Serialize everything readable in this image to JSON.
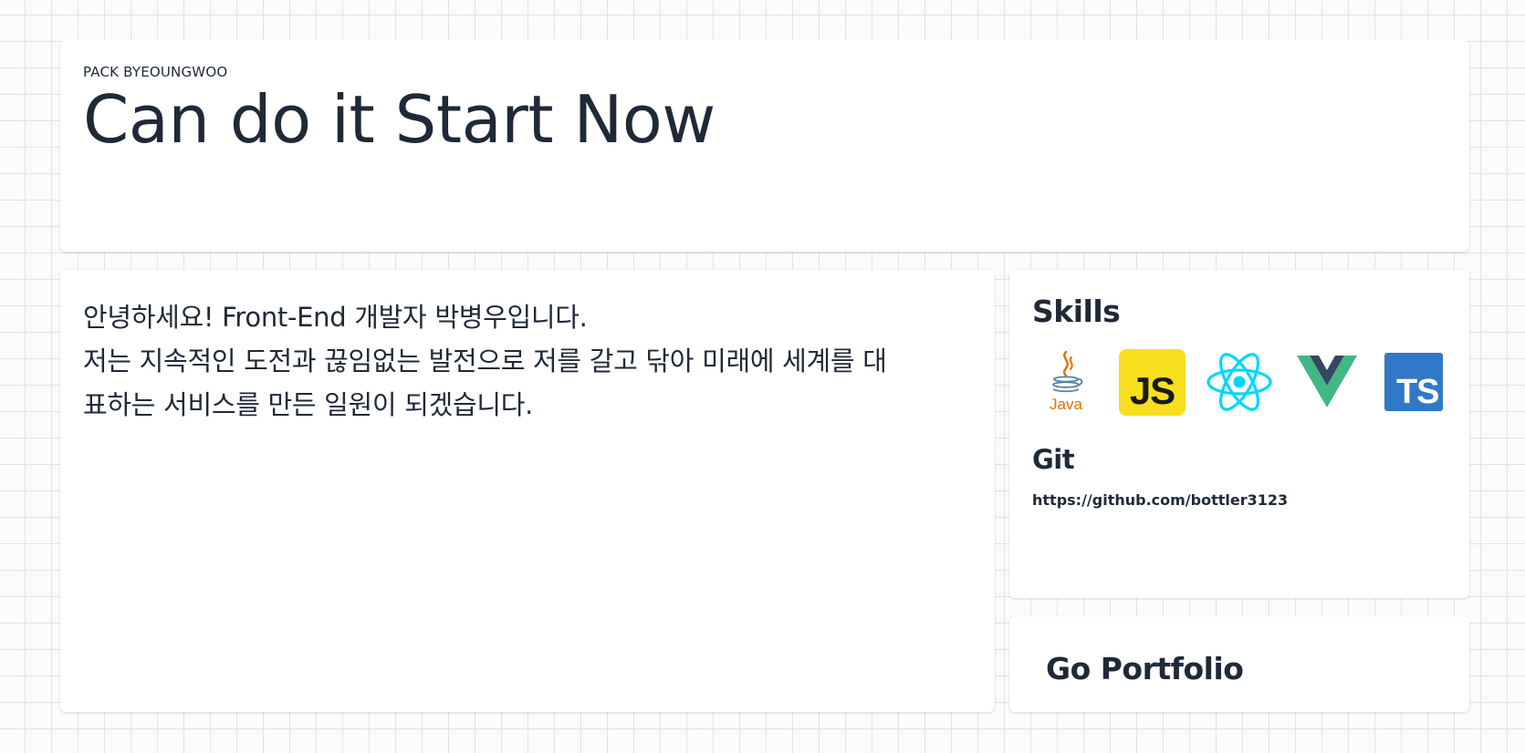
{
  "hero": {
    "eyebrow": "PACK BYEOUNGWOO",
    "title": "Can do it Start Now"
  },
  "intro": {
    "line1": "안녕하세요! Front-End 개발자 박병우입니다.",
    "line2": "저는 지속적인 도전과 끊임없는 발전으로 저를 갈고 닦아 미래에 세계를 대",
    "line3": "표하는 서비스를 만든 일원이 되겠습니다."
  },
  "skills": {
    "heading": "Skills",
    "items": [
      {
        "icon": "java-icon",
        "label": "Java"
      },
      {
        "icon": "javascript-icon",
        "label": "JS"
      },
      {
        "icon": "react-icon"
      },
      {
        "icon": "vue-icon"
      },
      {
        "icon": "typescript-icon",
        "label": "TS"
      }
    ]
  },
  "git": {
    "heading": "Git",
    "url": "https://github.com/bottler3123"
  },
  "portfolio": {
    "label": "Go Portfolio"
  },
  "colors": {
    "text": "#1f2937",
    "js_yellow": "#f7df1e",
    "ts_blue": "#3178c6",
    "react_cyan": "#00d8ff",
    "vue_green": "#41b883",
    "vue_dark": "#35495e",
    "java_orange": "#e76f00",
    "java_blue": "#5382a1"
  }
}
